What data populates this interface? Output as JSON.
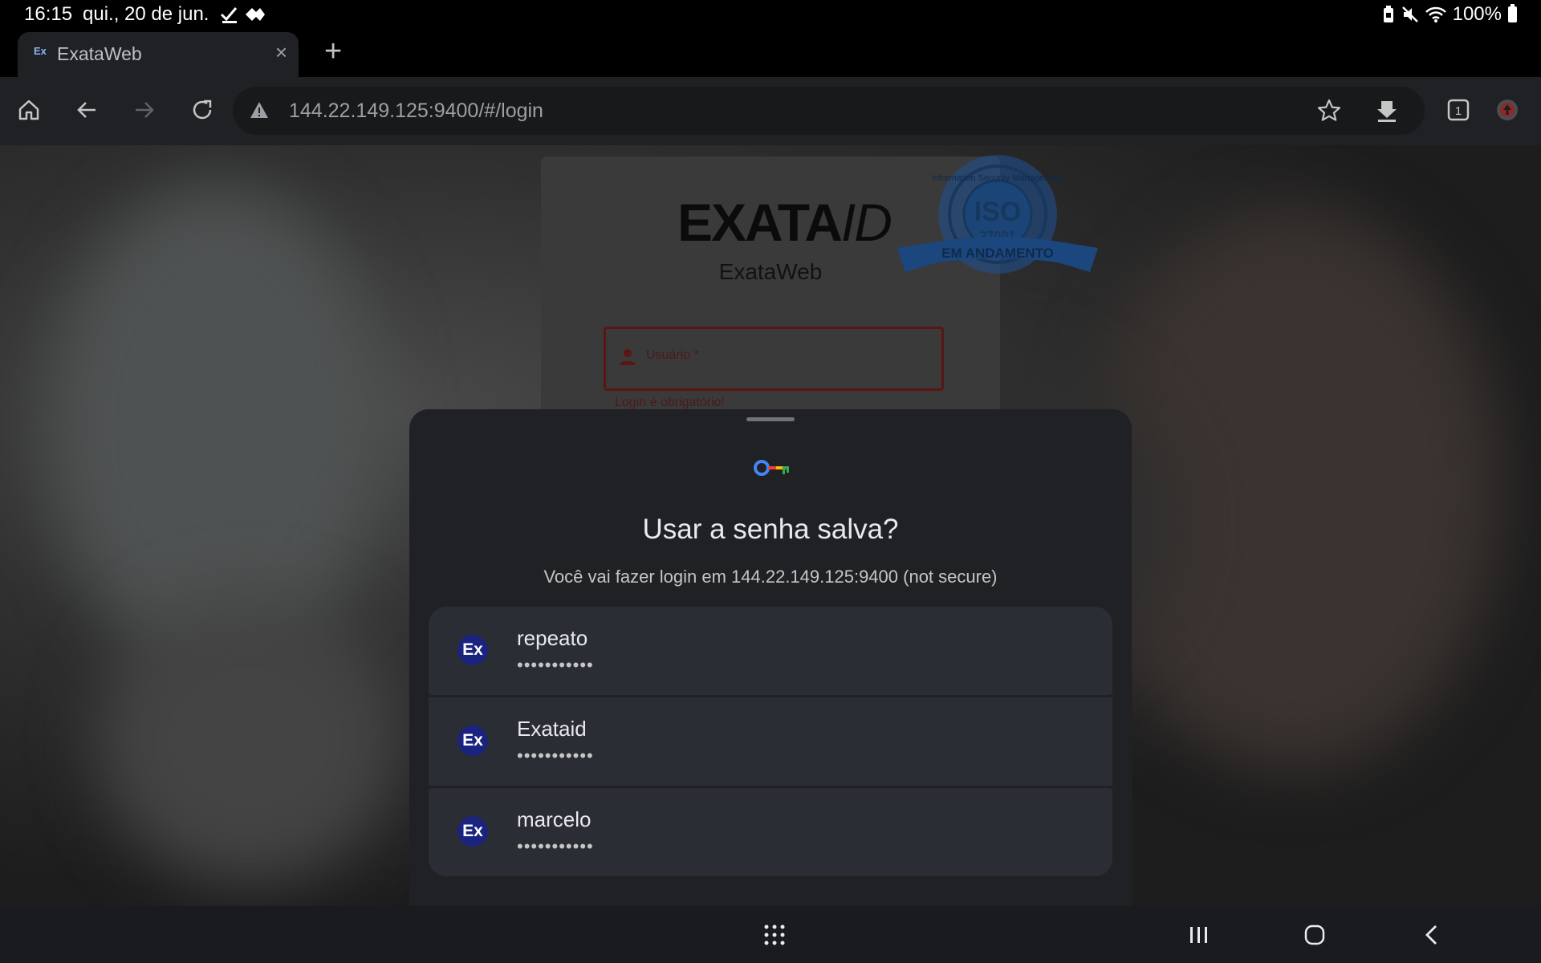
{
  "status_bar": {
    "time": "16:15",
    "date": "qui., 20 de jun.",
    "battery": "100%",
    "icons_left": [
      "check-icon",
      "diamond-arrows-icon"
    ],
    "icons_right": [
      "battery-saver-icon",
      "mute-icon",
      "wifi-icon",
      "battery-icon"
    ]
  },
  "browser": {
    "tab": {
      "favicon": "Ex",
      "title": "ExataWeb"
    },
    "url": "144.22.149.125:9400/#/login",
    "tab_count": "1"
  },
  "login_page": {
    "logo_text": "EXATA",
    "logo_suffix": "ID",
    "app_name": "ExataWeb",
    "username_placeholder": "Usuário *",
    "error_message": "Login é obrigatório!",
    "badge": {
      "top_text": "Information Security Management",
      "title": "ISO",
      "number": "27001",
      "ribbon": "EM ANDAMENTO"
    }
  },
  "password_sheet": {
    "title": "Usar a senha salva?",
    "subtitle": "Você vai fazer login em 144.22.149.125:9400 (not secure)",
    "credentials": [
      {
        "avatar": "Ex",
        "username": "repeato",
        "password_mask": "•••••••••••"
      },
      {
        "avatar": "Ex",
        "username": "Exataid",
        "password_mask": "•••••••••••"
      },
      {
        "avatar": "Ex",
        "username": "marcelo",
        "password_mask": "•••••••••••"
      }
    ]
  },
  "colors": {
    "sheet_bg": "#1f2124",
    "row_bg": "#2a2d33",
    "avatar_bg": "#1a237e",
    "badge_blue": "#1f4f8c"
  }
}
